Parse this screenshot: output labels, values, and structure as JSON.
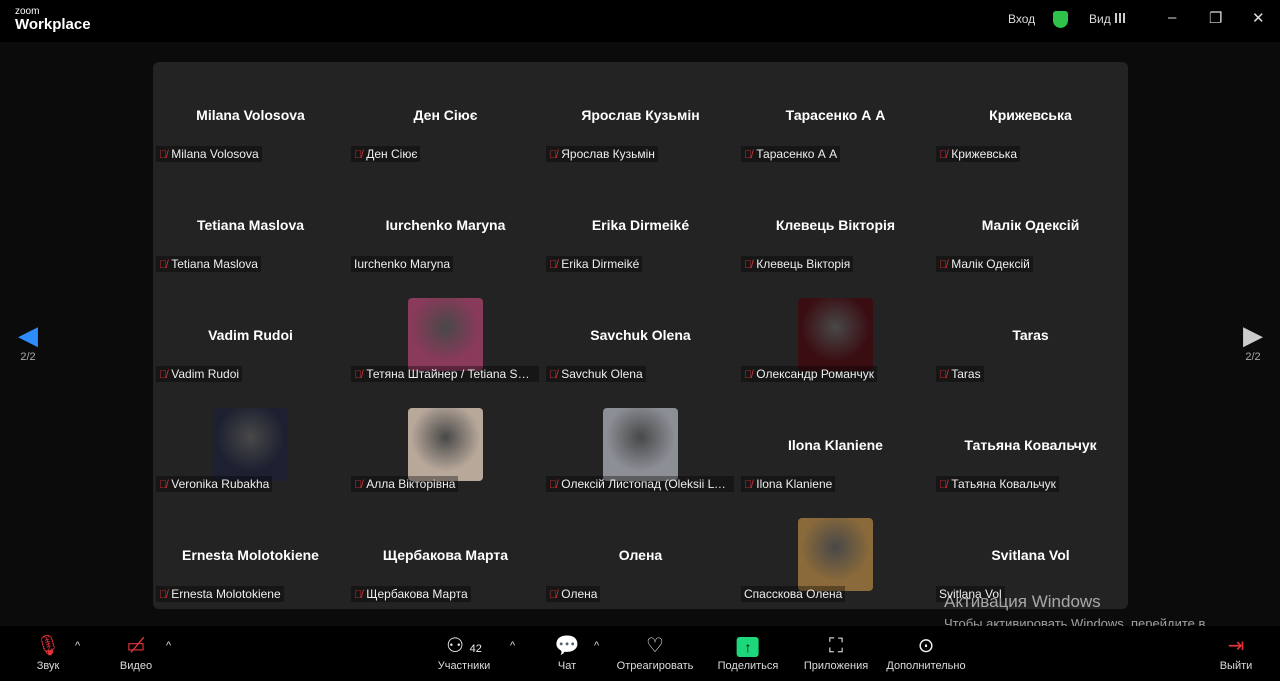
{
  "app": {
    "logo_small": "zoom",
    "logo_big": "Workplace",
    "signin": "Вход",
    "view": "Вид"
  },
  "page_indicator": "2/2",
  "tiles": [
    {
      "name": "Milana Volosova",
      "label": "Milana Volosova",
      "muted": true
    },
    {
      "name": "Ден Сіює",
      "label": "Ден Сіює",
      "muted": true
    },
    {
      "name": "Ярослав Кузьмін",
      "label": "Ярослав Кузьмін",
      "muted": true
    },
    {
      "name": "Тарасенко А А",
      "label": "Тарасенко А А",
      "muted": true
    },
    {
      "name": "Крижевська",
      "label": "Крижевська",
      "muted": true
    },
    {
      "name": "Tetiana Maslova",
      "label": "Tetiana Maslova",
      "muted": true
    },
    {
      "name": "Iurchenko Maryna",
      "label": "Iurchenko Maryna",
      "muted": false
    },
    {
      "name": "Erika Dirmeiké",
      "label": "Erika Dirmeiké",
      "muted": true
    },
    {
      "name": "Клевець Вікторія",
      "label": "Клевець Вікторія",
      "muted": true
    },
    {
      "name": "Малік Одексій",
      "label": "Малік Одексій",
      "muted": true
    },
    {
      "name": "Vadim Rudoi",
      "label": "Vadim Rudoi",
      "muted": true
    },
    {
      "name": "",
      "label": "Тетяна Штайнер / Tetiana Shtainer",
      "muted": true,
      "photo": "#8a3a5a"
    },
    {
      "name": "Savchuk Olena",
      "label": "Savchuk Olena",
      "muted": true
    },
    {
      "name": "",
      "label": "Олександр Романчук",
      "muted": true,
      "photo": "#3a0d12"
    },
    {
      "name": "Taras",
      "label": "Taras",
      "muted": true
    },
    {
      "name": "",
      "label": "Veronika Rubakha",
      "muted": true,
      "photo": "#1c2030"
    },
    {
      "name": "",
      "label": "Алла Вікторівна",
      "muted": true,
      "photo": "#b8a89a"
    },
    {
      "name": "",
      "label": "Олексій Листопад (Oleksii Lystopad)",
      "muted": true,
      "photo": "#8c8f96"
    },
    {
      "name": "Ilona Klaniene",
      "label": "Ilona Klaniene",
      "muted": true
    },
    {
      "name": "Татьяна Ковальчук",
      "label": "Татьяна Ковальчук",
      "muted": true
    },
    {
      "name": "Ernesta Molotokiene",
      "label": "Ernesta Molotokiene",
      "muted": true
    },
    {
      "name": "Щербакова Марта",
      "label": "Щербакова Марта",
      "muted": true
    },
    {
      "name": "Олена",
      "label": "Олена",
      "muted": true
    },
    {
      "name": "",
      "label": "Спасскова Олена",
      "muted": false,
      "photo": "#8a6a3a"
    },
    {
      "name": "Svitlana Vol",
      "label": "Svitlana Vol",
      "muted": false
    }
  ],
  "toolbar": {
    "audio": "Звук",
    "video": "Видео",
    "participants": "Участники",
    "participants_count": "42",
    "chat": "Чат",
    "react": "Отреагировать",
    "share": "Поделиться",
    "apps": "Приложения",
    "more": "Дополнительно",
    "leave": "Выйти"
  },
  "watermark": {
    "title": "Активация Windows",
    "text": "Чтобы активировать Windows, перейдите в раздел \"Параметры\"."
  }
}
